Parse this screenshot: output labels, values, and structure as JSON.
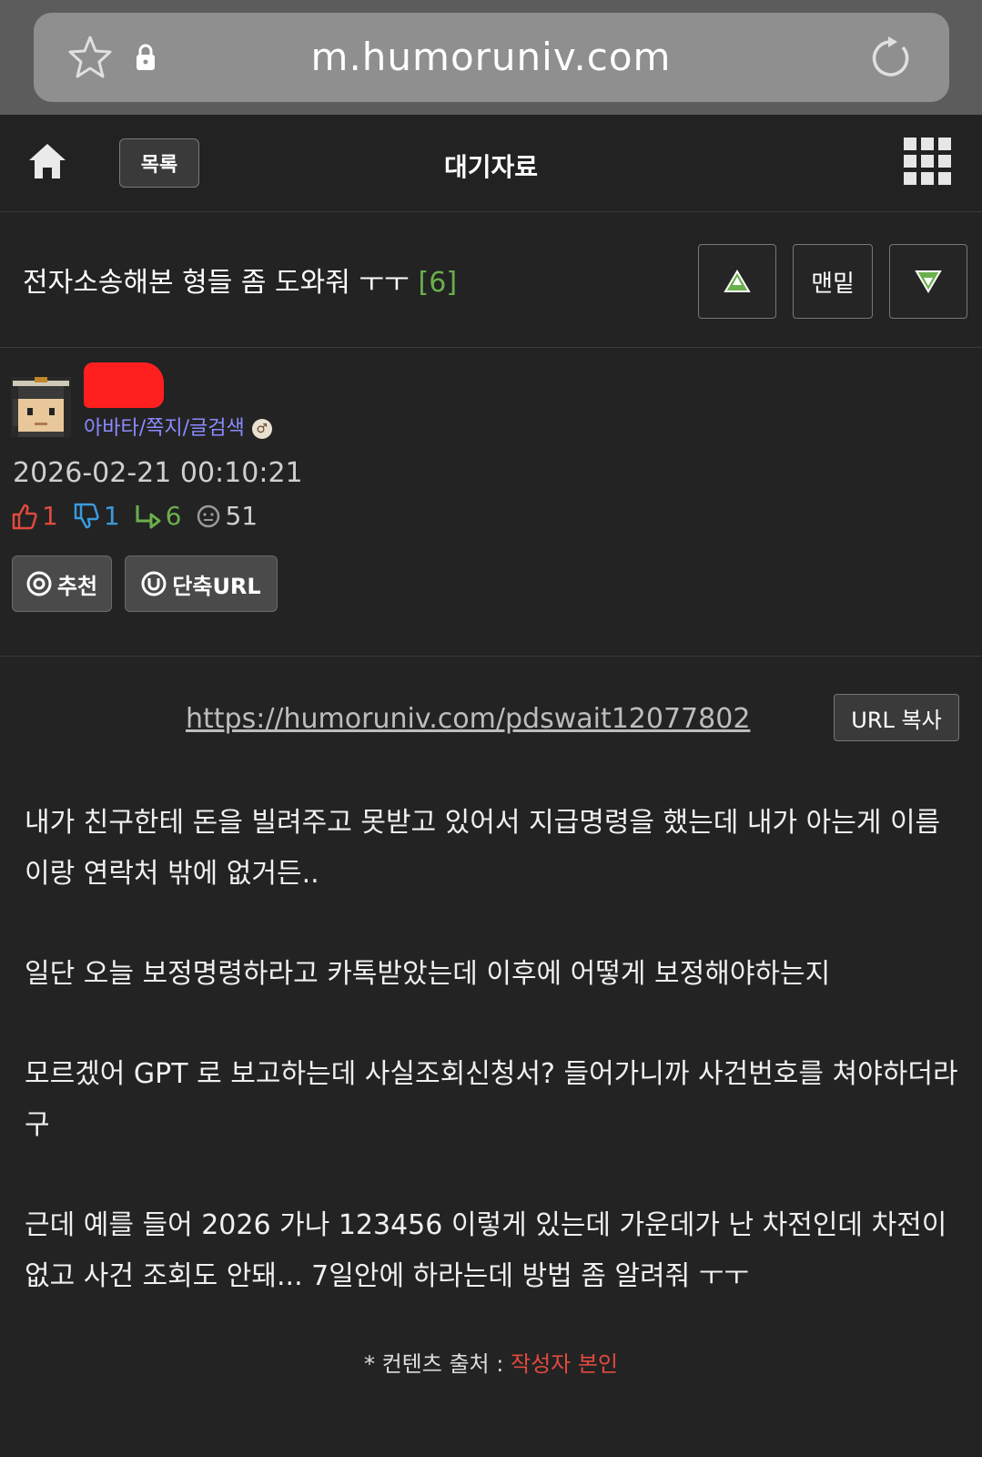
{
  "browser": {
    "url": "m.humoruniv.com",
    "icons": [
      "star-icon",
      "lock-icon",
      "reload-icon"
    ]
  },
  "nav": {
    "list_label": "목록",
    "board_title": "대기자료",
    "icons": [
      "home-icon",
      "grid-menu-icon"
    ]
  },
  "post": {
    "title": "전자소송해본 형들 좀 도와줘 ㅜㅜ",
    "comment_count": "[6]",
    "bottom_label": "맨밑"
  },
  "author": {
    "links": "아바타/쪽지/글검색",
    "date": "2026-02-21 00:10:21",
    "stats": {
      "up": "1",
      "down": "1",
      "replies": "6",
      "views": "51"
    },
    "recommend_label": "추천",
    "short_url_label": "단축URL"
  },
  "content": {
    "short_url": "https://humoruniv.com/pdswait12077802",
    "copy_label": "URL 복사",
    "paragraphs": [
      "내가 친구한테 돈을 빌려주고 못받고 있어서 지급명령을 했는데 내가 아는게 이름이랑 연락처 밖에 없거든..",
      "일단 오늘 보정명령하라고 카톡받았는데 이후에 어떻게 보정해야하는지",
      "모르겠어 GPT 로 보고하는데 사실조회신청서? 들어가니까 사건번호를 쳐야하더라구",
      "근데 예를 들어 2026 가나 123456 이렇게 있는데 가운데가 난 차전인데 차전이 없고 사건 조회도 안돼... 7일안에 하라는데 방법 좀 알려줘 ㅜㅜ"
    ],
    "source_label": "* 컨텐츠 출처 :",
    "source_value": "작성자 본인"
  },
  "colors": {
    "background": "#232323",
    "up": "#e04a3f",
    "down": "#3a9be0",
    "reply": "#6ab04c",
    "link": "#8b8bff"
  }
}
